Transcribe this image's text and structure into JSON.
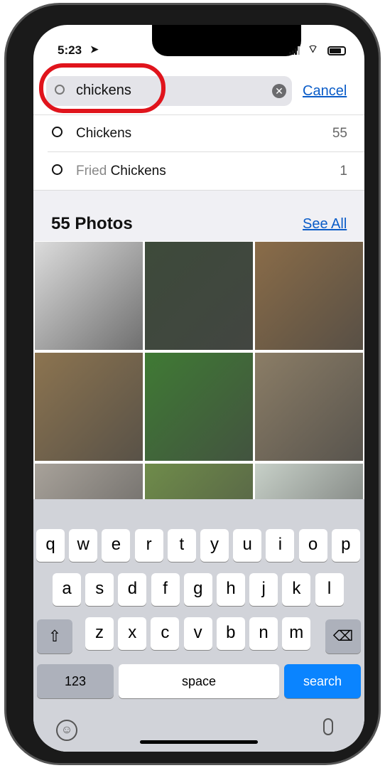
{
  "status": {
    "time": "5:23"
  },
  "search": {
    "value": "chickens",
    "cancel": "Cancel"
  },
  "suggestions": [
    {
      "dim": "",
      "text": "Chickens",
      "count": "55"
    },
    {
      "dim": "Fried ",
      "text": "Chickens",
      "count": "1"
    }
  ],
  "photos": {
    "title": "55 Photos",
    "see_all": "See All",
    "tiles": [
      "#dcdcdc",
      "#3d4a3a",
      "#8a6c48",
      "#8c7450",
      "#3f7a34",
      "#8b7d66",
      "#a8a29a",
      "#6f8c4a",
      "#c7d0c8"
    ]
  },
  "keyboard": {
    "row1": [
      "q",
      "w",
      "e",
      "r",
      "t",
      "y",
      "u",
      "i",
      "o",
      "p"
    ],
    "row2": [
      "a",
      "s",
      "d",
      "f",
      "g",
      "h",
      "j",
      "k",
      "l"
    ],
    "row3": [
      "z",
      "x",
      "c",
      "v",
      "b",
      "n",
      "m"
    ],
    "numbers": "123",
    "space": "space",
    "search": "search"
  },
  "colors": {
    "accent": "#0a84ff",
    "highlight": "#e0141c"
  }
}
